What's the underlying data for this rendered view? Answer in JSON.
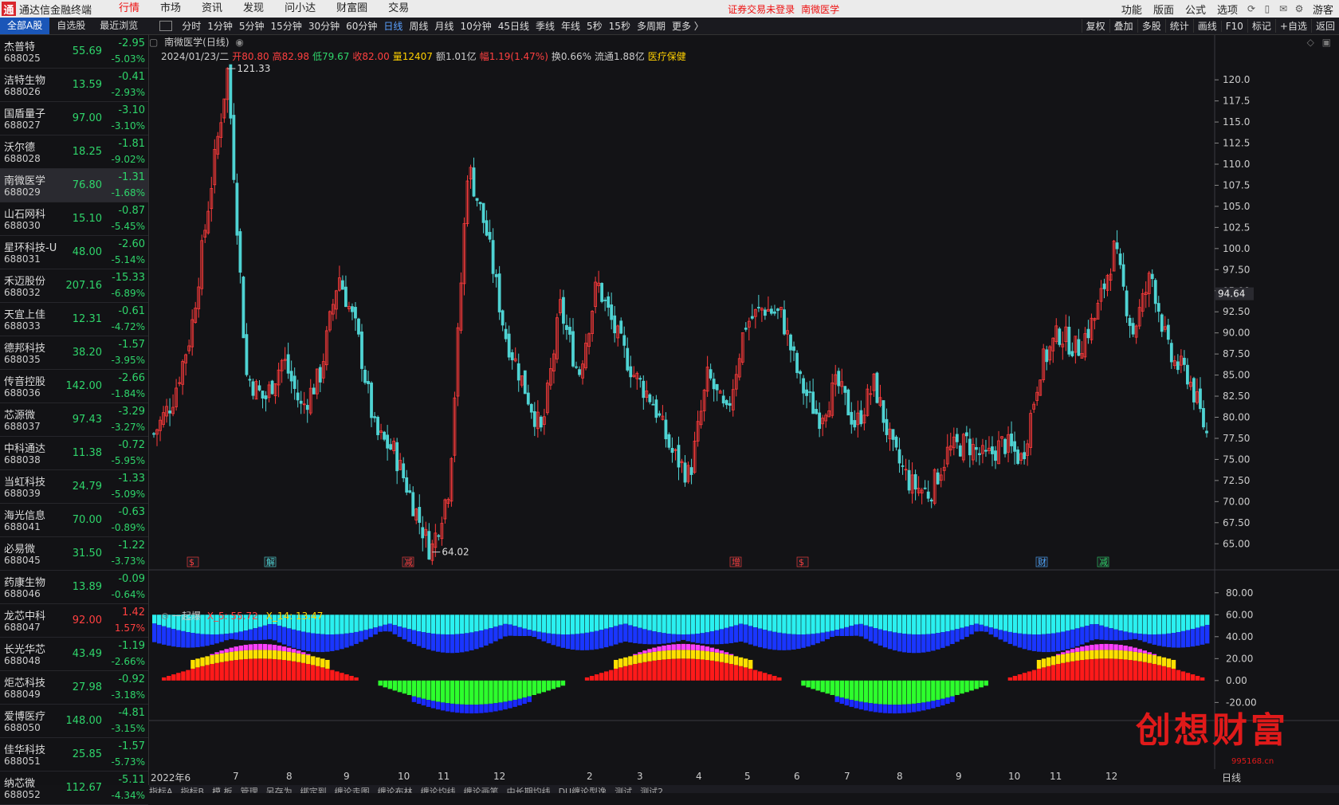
{
  "app": {
    "title": "通达信金融终端",
    "notice": "证券交易未登录",
    "notice_stock": "南微医学"
  },
  "menu": [
    "行情",
    "市场",
    "资讯",
    "发现",
    "问小达",
    "财富圈",
    "交易"
  ],
  "menu_right": [
    "功能",
    "版面",
    "公式",
    "选项"
  ],
  "menu_right_end": "游客",
  "tabs": [
    "全部A股",
    "自选股",
    "最近浏览"
  ],
  "periods": [
    "分时",
    "1分钟",
    "5分钟",
    "15分钟",
    "30分钟",
    "60分钟",
    "日线",
    "周线",
    "月线",
    "10分钟",
    "45日线",
    "季线",
    "年线",
    "5秒",
    "15秒",
    "多周期",
    "更多 〉"
  ],
  "tools": [
    "复权",
    "叠加",
    "多股",
    "统计",
    "画线",
    "F10",
    "标记",
    "+自选",
    "返回"
  ],
  "stocks": [
    {
      "name": "杰普特",
      "code": "688025",
      "price": "55.69",
      "chg": "-2.95",
      "pct": "-5.03%",
      "dir": "down"
    },
    {
      "name": "洁特生物",
      "code": "688026",
      "price": "13.59",
      "chg": "-0.41",
      "pct": "-2.93%",
      "dir": "down"
    },
    {
      "name": "国盾量子",
      "code": "688027",
      "price": "97.00",
      "chg": "-3.10",
      "pct": "-3.10%",
      "dir": "down"
    },
    {
      "name": "沃尔德",
      "code": "688028",
      "price": "18.25",
      "chg": "-1.81",
      "pct": "-9.02%",
      "dir": "down"
    },
    {
      "name": "南微医学",
      "code": "688029",
      "price": "76.80",
      "chg": "-1.31",
      "pct": "-1.68%",
      "dir": "down"
    },
    {
      "name": "山石网科",
      "code": "688030",
      "price": "15.10",
      "chg": "-0.87",
      "pct": "-5.45%",
      "dir": "down"
    },
    {
      "name": "星环科技-U",
      "code": "688031",
      "price": "48.00",
      "chg": "-2.60",
      "pct": "-5.14%",
      "dir": "down"
    },
    {
      "name": "禾迈股份",
      "code": "688032",
      "price": "207.16",
      "chg": "-15.33",
      "pct": "-6.89%",
      "dir": "down"
    },
    {
      "name": "天宜上佳",
      "code": "688033",
      "price": "12.31",
      "chg": "-0.61",
      "pct": "-4.72%",
      "dir": "down"
    },
    {
      "name": "德邦科技",
      "code": "688035",
      "price": "38.20",
      "chg": "-1.57",
      "pct": "-3.95%",
      "dir": "down"
    },
    {
      "name": "传音控股",
      "code": "688036",
      "price": "142.00",
      "chg": "-2.66",
      "pct": "-1.84%",
      "dir": "down"
    },
    {
      "name": "芯源微",
      "code": "688037",
      "price": "97.43",
      "chg": "-3.29",
      "pct": "-3.27%",
      "dir": "down"
    },
    {
      "name": "中科通达",
      "code": "688038",
      "price": "11.38",
      "chg": "-0.72",
      "pct": "-5.95%",
      "dir": "down"
    },
    {
      "name": "当虹科技",
      "code": "688039",
      "price": "24.79",
      "chg": "-1.33",
      "pct": "-5.09%",
      "dir": "down"
    },
    {
      "name": "海光信息",
      "code": "688041",
      "price": "70.00",
      "chg": "-0.63",
      "pct": "-0.89%",
      "dir": "down"
    },
    {
      "name": "必易微",
      "code": "688045",
      "price": "31.50",
      "chg": "-1.22",
      "pct": "-3.73%",
      "dir": "down"
    },
    {
      "name": "药康生物",
      "code": "688046",
      "price": "13.89",
      "chg": "-0.09",
      "pct": "-0.64%",
      "dir": "down"
    },
    {
      "name": "龙芯中科",
      "code": "688047",
      "price": "92.00",
      "chg": "1.42",
      "pct": "1.57%",
      "dir": "up"
    },
    {
      "name": "长光华芯",
      "code": "688048",
      "price": "43.49",
      "chg": "-1.19",
      "pct": "-2.66%",
      "dir": "down"
    },
    {
      "name": "炬芯科技",
      "code": "688049",
      "price": "27.98",
      "chg": "-0.92",
      "pct": "-3.18%",
      "dir": "down"
    },
    {
      "name": "爱博医疗",
      "code": "688050",
      "price": "148.00",
      "chg": "-4.81",
      "pct": "-3.15%",
      "dir": "down"
    },
    {
      "name": "佳华科技",
      "code": "688051",
      "price": "25.85",
      "chg": "-1.57",
      "pct": "-5.73%",
      "dir": "down"
    },
    {
      "name": "纳芯微",
      "code": "688052",
      "price": "112.67",
      "chg": "-5.11",
      "pct": "-4.34%",
      "dir": "down"
    }
  ],
  "chart": {
    "stock_title": "南微医学(日线)",
    "date": "2024/01/23/二",
    "open_label": "开",
    "open": "80.80",
    "high_label": "高",
    "high": "82.98",
    "low_label": "低",
    "low": "79.67",
    "close_label": "收",
    "close": "82.00",
    "vol_label": "量",
    "vol": "12407",
    "amt_label": "额",
    "amt": "1.01亿",
    "amp_label": "幅",
    "amp": "1.19(1.47%)",
    "turn_label": "换",
    "turn": "0.66%",
    "float_label": "流通",
    "float": "1.88亿",
    "sector": "医疗保健",
    "max_label": "121.33",
    "min_label": "64.02",
    "current_price": "94.64",
    "price_ticks": [
      "120.0",
      "117.5",
      "115.0",
      "112.5",
      "110.0",
      "107.5",
      "105.0",
      "102.5",
      "100.0",
      "97.50",
      "95.00",
      "92.50",
      "90.00",
      "87.50",
      "85.00",
      "82.50",
      "80.00",
      "77.50",
      "75.00",
      "72.50",
      "70.00",
      "67.50",
      "65.00"
    ],
    "event_marks": [
      "$",
      "解",
      "减",
      "增",
      "$",
      "财",
      "减"
    ],
    "date_ticks": [
      "2022年6",
      "7",
      "8",
      "9",
      "10",
      "11",
      "12",
      "2",
      "3",
      "4",
      "5",
      "6",
      "7",
      "8",
      "9",
      "10",
      "11",
      "12"
    ],
    "date_axis_right": "日线"
  },
  "chart_data": {
    "type": "candlestick",
    "title": "南微医学(日线)",
    "ylim": [
      62,
      122
    ],
    "annotated_high": 121.33,
    "annotated_low": 64.02,
    "last": {
      "open": 80.8,
      "high": 82.98,
      "low": 79.67,
      "close": 82.0
    },
    "path": [
      {
        "d": "2022-06",
        "p": 78
      },
      {
        "d": "2022-06b",
        "p": 82
      },
      {
        "d": "2022-06c",
        "p": 90
      },
      {
        "d": "2022-06d",
        "p": 106
      },
      {
        "d": "2022-06e",
        "p": 121.33
      },
      {
        "d": "2022-07a",
        "p": 85
      },
      {
        "d": "2022-07b",
        "p": 82
      },
      {
        "d": "2022-07c",
        "p": 87
      },
      {
        "d": "2022-07d",
        "p": 81
      },
      {
        "d": "2022-08a",
        "p": 85
      },
      {
        "d": "2022-08b",
        "p": 97
      },
      {
        "d": "2022-08c",
        "p": 90
      },
      {
        "d": "2022-09a",
        "p": 78
      },
      {
        "d": "2022-09b",
        "p": 76
      },
      {
        "d": "2022-09c",
        "p": 70
      },
      {
        "d": "2022-10a",
        "p": 64.02
      },
      {
        "d": "2022-10b",
        "p": 72
      },
      {
        "d": "2022-10c",
        "p": 110
      },
      {
        "d": "2022-11a",
        "p": 102
      },
      {
        "d": "2022-11b",
        "p": 90
      },
      {
        "d": "2022-11c",
        "p": 84
      },
      {
        "d": "2022-12a",
        "p": 78
      },
      {
        "d": "2022-12b",
        "p": 93
      },
      {
        "d": "2023-01",
        "p": 85
      },
      {
        "d": "2023-02a",
        "p": 96
      },
      {
        "d": "2023-02b",
        "p": 90
      },
      {
        "d": "2023-03a",
        "p": 85
      },
      {
        "d": "2023-03b",
        "p": 82
      },
      {
        "d": "2023-04a",
        "p": 76
      },
      {
        "d": "2023-04b",
        "p": 73
      },
      {
        "d": "2023-04c",
        "p": 85
      },
      {
        "d": "2023-05a",
        "p": 80
      },
      {
        "d": "2023-05b",
        "p": 91
      },
      {
        "d": "2023-05c",
        "p": 93
      },
      {
        "d": "2023-06a",
        "p": 92
      },
      {
        "d": "2023-06b",
        "p": 84
      },
      {
        "d": "2023-07a",
        "p": 80
      },
      {
        "d": "2023-07b",
        "p": 84
      },
      {
        "d": "2023-07c",
        "p": 79
      },
      {
        "d": "2023-08a",
        "p": 84
      },
      {
        "d": "2023-08b",
        "p": 76
      },
      {
        "d": "2023-09a",
        "p": 72
      },
      {
        "d": "2023-09b",
        "p": 71
      },
      {
        "d": "2023-09c",
        "p": 76
      },
      {
        "d": "2023-10a",
        "p": 77
      },
      {
        "d": "2023-10b",
        "p": 75
      },
      {
        "d": "2023-10c",
        "p": 77
      },
      {
        "d": "2023-11a",
        "p": 75
      },
      {
        "d": "2023-11b",
        "p": 86
      },
      {
        "d": "2023-11c",
        "p": 90
      },
      {
        "d": "2023-12a",
        "p": 88
      },
      {
        "d": "2023-12b",
        "p": 92
      },
      {
        "d": "2023-12c",
        "p": 100
      },
      {
        "d": "2024-01a",
        "p": 90
      },
      {
        "d": "2024-01b",
        "p": 97
      },
      {
        "d": "2024-01c",
        "p": 87
      },
      {
        "d": "2024-01d",
        "p": 85
      },
      {
        "d": "2024-01e",
        "p": 78
      }
    ],
    "indicator": {
      "name": "一起爆",
      "series": [
        {
          "name": "X_5",
          "last": "55.72",
          "color": "#ff4040"
        },
        {
          "name": "X_14",
          "last": "13.47",
          "color": "#ffd000"
        }
      ],
      "ylim": [
        -35,
        90
      ],
      "ticks": [
        "80.00",
        "60.00",
        "40.00",
        "20.00",
        "0.00",
        "-20.00"
      ]
    }
  },
  "bottom_tabs": [
    "指标A",
    "指标B",
    "模 板",
    "管理",
    "另存为",
    "绑定到",
    "缠论走图",
    "缠论布林",
    "缠论均线",
    "缠论画笔",
    "中长期均线",
    "DU缠论型逸",
    "测试",
    "测试2"
  ],
  "watermark": "创想财富",
  "watermark_small": "995168.cn"
}
